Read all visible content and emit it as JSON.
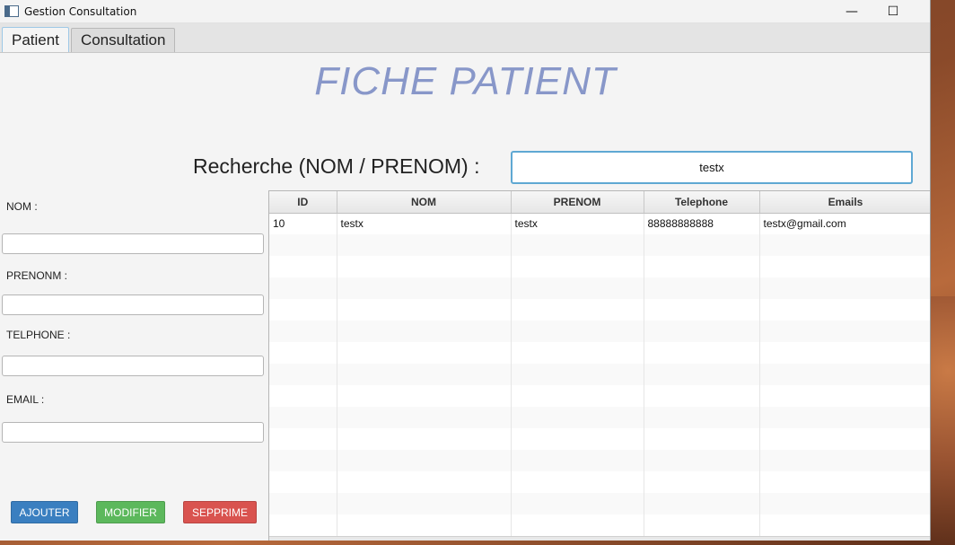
{
  "window": {
    "title": "Gestion Consultation"
  },
  "controls": {
    "minimize": "—",
    "maximize": "☐",
    "close": "✕"
  },
  "tabs": [
    {
      "label": "Patient",
      "active": true
    },
    {
      "label": "Consultation",
      "active": false
    }
  ],
  "page": {
    "title": "FICHE PATIENT"
  },
  "search": {
    "label": "Recherche (NOM / PRENOM) :",
    "value": "testx"
  },
  "form": {
    "nom_label": "NOM :",
    "prenom_label": "PRENONM :",
    "telephone_label": "TELPHONE :",
    "email_label": "EMAIL :"
  },
  "buttons": {
    "add": "AJOUTER",
    "edit": "MODIFIER",
    "delete": "SEPPRIME"
  },
  "table": {
    "columns": [
      "ID",
      "NOM",
      "PRENOM",
      "Telephone",
      "Emails"
    ],
    "rows": [
      [
        "10",
        "testx",
        "testx",
        "88888888888",
        "testx@gmail.com"
      ]
    ],
    "empty_rows": 15
  },
  "colors": {
    "title": "#8897c9",
    "add_button": "#3a7fc0",
    "edit_button": "#5cb85c",
    "delete_button": "#d9534f",
    "focus_border": "#5fa8d3"
  }
}
